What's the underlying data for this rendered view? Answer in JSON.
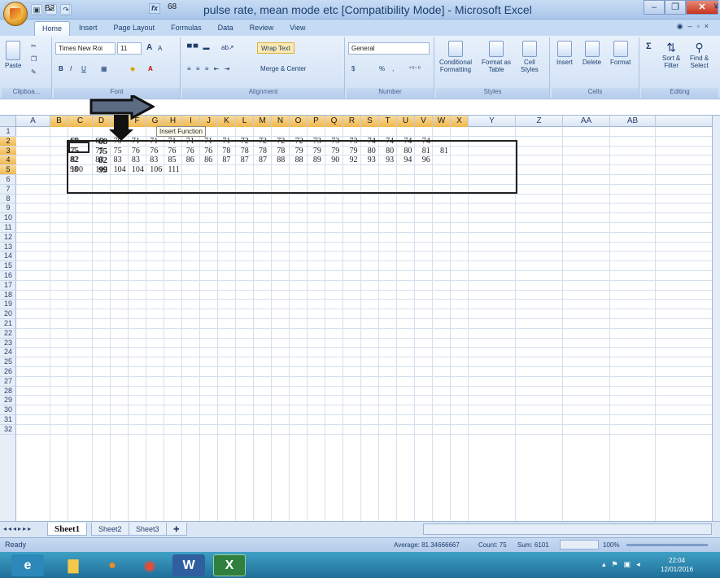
{
  "window": {
    "title": "pulse rate, mean mode etc  [Compatibility Mode] - Microsoft Excel",
    "minimize": "–",
    "restore": "❐",
    "close": "✕"
  },
  "qat": {
    "save": "▣",
    "undo": "↶",
    "redo": "↷"
  },
  "tabs": [
    "Home",
    "Insert",
    "Page Layout",
    "Formulas",
    "Data",
    "Review",
    "View"
  ],
  "ribbon": {
    "clipboard": {
      "paste": "Paste",
      "label": "Clipboa..."
    },
    "font": {
      "name": "Times New Roi",
      "size": "11",
      "bold": "B",
      "italic": "I",
      "underline": "U",
      "grow": "A",
      "shrink": "A",
      "label": "Font"
    },
    "alignment": {
      "wrap": "Wrap Text",
      "merge": "Merge & Center",
      "label": "Alignment"
    },
    "number": {
      "format": "General",
      "percent": "%",
      "comma": ",",
      "label": "Number"
    },
    "styles": {
      "conditional": "Conditional",
      "formatting": "Formatting",
      "format_as": "Format as",
      "table": "Table",
      "cell": "Cell",
      "styles_btn": "Styles",
      "label": "Styles"
    },
    "cells": {
      "insert": "Insert",
      "delete": "Delete",
      "format": "Format",
      "label": "Cells"
    },
    "editing": {
      "sum": "Σ",
      "sort1": "Sort &",
      "sort2": "Filter",
      "find1": "Find &",
      "find2": "Select",
      "label": "Editing"
    }
  },
  "formula_bar": {
    "name_box": "B2",
    "fx": "fx",
    "value": "68",
    "tooltip": "Insert Function"
  },
  "columns": [
    "A",
    "B",
    "C",
    "D",
    "E",
    "F",
    "G",
    "H",
    "I",
    "J",
    "K",
    "L",
    "M",
    "N",
    "O",
    "P",
    "Q",
    "R",
    "S",
    "T",
    "U",
    "V",
    "W",
    "X",
    "Y",
    "Z",
    "AA",
    "AB"
  ],
  "rows": [
    "1",
    "2",
    "3",
    "4",
    "5",
    "6",
    "7",
    "8",
    "9",
    "10",
    "11",
    "12",
    "13",
    "14",
    "15",
    "16",
    "17",
    "18",
    "19",
    "20",
    "21",
    "22",
    "23",
    "24",
    "25",
    "26",
    "27",
    "28",
    "29",
    "30",
    "31",
    "32"
  ],
  "cell_data": [
    [
      "68",
      "68",
      "69",
      "69",
      "70",
      "71",
      "71",
      "71",
      "71",
      "71",
      "71",
      "72",
      "72",
      "72",
      "72",
      "73",
      "73",
      "73",
      "74",
      "74",
      "74",
      "74"
    ],
    [
      "75",
      "75",
      "75",
      "75",
      "75",
      "76",
      "76",
      "76",
      "76",
      "76",
      "78",
      "78",
      "78",
      "78",
      "79",
      "79",
      "79",
      "79",
      "80",
      "80",
      "80",
      "81",
      "81"
    ],
    [
      "82",
      "82",
      "82",
      "83",
      "83",
      "83",
      "83",
      "85",
      "86",
      "86",
      "87",
      "87",
      "87",
      "88",
      "88",
      "89",
      "90",
      "92",
      "93",
      "93",
      "94",
      "96"
    ],
    [
      "98",
      "99",
      "100",
      "102",
      "104",
      "104",
      "106",
      "111"
    ]
  ],
  "sheets": [
    "Sheet1",
    "Sheet2",
    "Sheet3"
  ],
  "status": {
    "ready": "Ready",
    "average": "Average: 81.34666667",
    "count": "Count: 75",
    "sum": "Sum: 6101",
    "zoom": "100%"
  },
  "taskbar": {
    "time": "22:04",
    "date": "12/01/2016"
  },
  "colors": {
    "selected_header": "#f1b84d",
    "ribbon": "#cfe0f5",
    "taskbar": "#1f6f98"
  }
}
